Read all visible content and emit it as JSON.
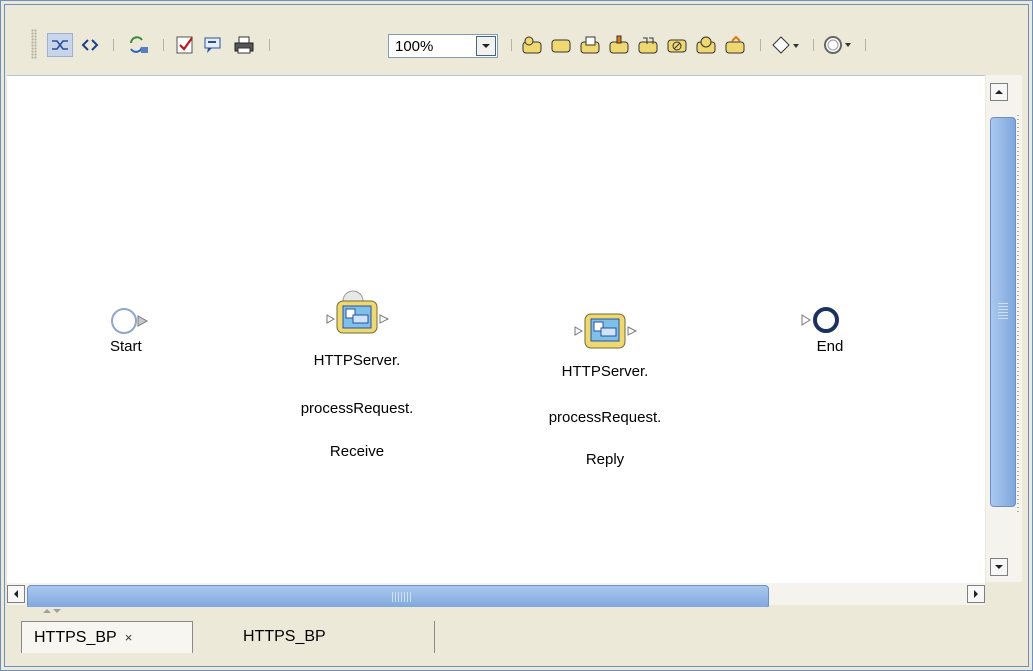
{
  "toolbar": {
    "zoom_value": "100%",
    "icons": [
      "link-icon",
      "code-icon",
      "sync-icon",
      "validate-icon",
      "comment-icon",
      "print-icon",
      "receive-activity-icon",
      "empty-activity-icon",
      "assign-icon",
      "invoke-icon",
      "compensate-icon",
      "throw-icon",
      "wait-icon",
      "reply-activity-icon",
      "decision-icon",
      "intermediate-event-icon"
    ]
  },
  "diagram": {
    "nodes": [
      {
        "id": "start",
        "label": "Start"
      },
      {
        "id": "receive",
        "label_lines": [
          "HTTPServer.",
          "processRequest.",
          "Receive"
        ]
      },
      {
        "id": "reply",
        "label_lines": [
          "HTTPServer.",
          "processRequest.",
          "Reply"
        ]
      },
      {
        "id": "end",
        "label": "End"
      }
    ]
  },
  "tabs": [
    {
      "label": "HTTPS_BP",
      "close": "×",
      "active": true
    },
    {
      "label": "HTTPS_BP",
      "active": false
    }
  ],
  "colors": {
    "accent": "#6f8fbf",
    "scroll_thumb": "#7fa7dc",
    "activity_fill": "#f0d870"
  }
}
